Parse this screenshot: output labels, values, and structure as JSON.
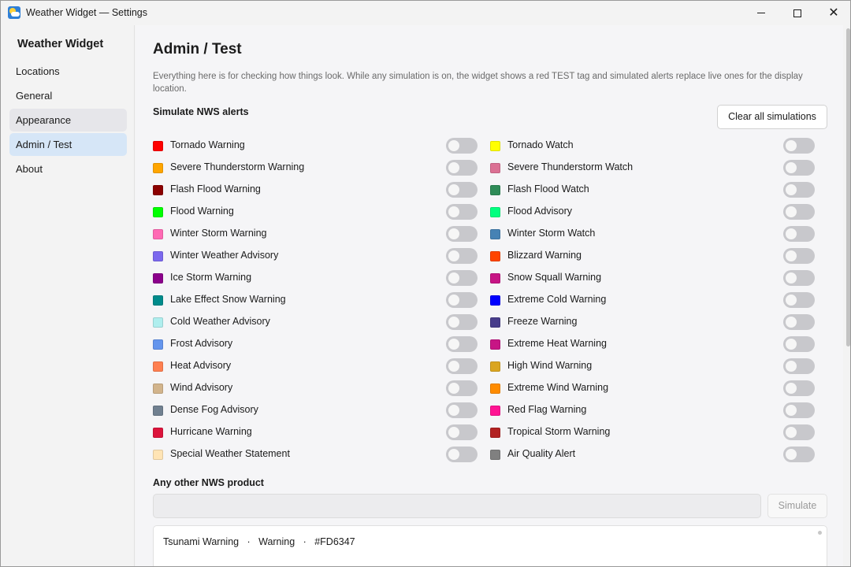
{
  "window": {
    "title": "Weather Widget — Settings"
  },
  "sidebar": {
    "title": "Weather Widget",
    "items": [
      {
        "label": "Locations"
      },
      {
        "label": "General"
      },
      {
        "label": "Appearance"
      },
      {
        "label": "Admin / Test"
      },
      {
        "label": "About"
      }
    ],
    "active": "Admin / Test",
    "hovered": "Appearance"
  },
  "main": {
    "title": "Admin / Test",
    "description": "Everything here is for checking how things look. While any simulation is on, the widget shows a red TEST tag and simulated alerts replace live ones for the display location.",
    "simulate_section": "Simulate NWS alerts",
    "clear_button": "Clear all simulations",
    "alerts_left": [
      {
        "label": "Tornado Warning",
        "color": "#FF0000",
        "on": false
      },
      {
        "label": "Severe Thunderstorm Warning",
        "color": "#FFA500",
        "on": false
      },
      {
        "label": "Flash Flood Warning",
        "color": "#8B0000",
        "on": false
      },
      {
        "label": "Flood Warning",
        "color": "#00FF00",
        "on": false
      },
      {
        "label": "Winter Storm Warning",
        "color": "#FF69B4",
        "on": false
      },
      {
        "label": "Winter Weather Advisory",
        "color": "#7B68EE",
        "on": false
      },
      {
        "label": "Ice Storm Warning",
        "color": "#8B008B",
        "on": false
      },
      {
        "label": "Lake Effect Snow Warning",
        "color": "#008B8B",
        "on": false
      },
      {
        "label": "Cold Weather Advisory",
        "color": "#AFEEEE",
        "on": false
      },
      {
        "label": "Frost Advisory",
        "color": "#6495ED",
        "on": false
      },
      {
        "label": "Heat Advisory",
        "color": "#FF7F50",
        "on": false
      },
      {
        "label": "Wind Advisory",
        "color": "#D2B48C",
        "on": false
      },
      {
        "label": "Dense Fog Advisory",
        "color": "#708090",
        "on": false
      },
      {
        "label": "Hurricane Warning",
        "color": "#DC143C",
        "on": false
      },
      {
        "label": "Special Weather Statement",
        "color": "#FFE4B5",
        "on": false
      }
    ],
    "alerts_right": [
      {
        "label": "Tornado Watch",
        "color": "#FFFF00",
        "on": false
      },
      {
        "label": "Severe Thunderstorm Watch",
        "color": "#DB7093",
        "on": false
      },
      {
        "label": "Flash Flood Watch",
        "color": "#2E8B57",
        "on": false
      },
      {
        "label": "Flood Advisory",
        "color": "#00FF7F",
        "on": false
      },
      {
        "label": "Winter Storm Watch",
        "color": "#4682B4",
        "on": false
      },
      {
        "label": "Blizzard Warning",
        "color": "#FF4500",
        "on": false
      },
      {
        "label": "Snow Squall Warning",
        "color": "#C71585",
        "on": false
      },
      {
        "label": "Extreme Cold Warning",
        "color": "#0000FF",
        "on": false
      },
      {
        "label": "Freeze Warning",
        "color": "#483D8B",
        "on": false
      },
      {
        "label": "Extreme Heat Warning",
        "color": "#C71585",
        "on": false
      },
      {
        "label": "High Wind Warning",
        "color": "#DAA520",
        "on": false
      },
      {
        "label": "Extreme Wind Warning",
        "color": "#FF8C00",
        "on": false
      },
      {
        "label": "Red Flag Warning",
        "color": "#FF1493",
        "on": false
      },
      {
        "label": "Tropical Storm Warning",
        "color": "#B22222",
        "on": false
      },
      {
        "label": "Air Quality Alert",
        "color": "#808080",
        "on": false
      }
    ],
    "other_section": "Any other NWS product",
    "other_input": {
      "value": "",
      "placeholder": ""
    },
    "simulate_button": "Simulate",
    "result": {
      "name": "Tsunami Warning",
      "type": "Warning",
      "color_code": "#FD6347"
    }
  }
}
